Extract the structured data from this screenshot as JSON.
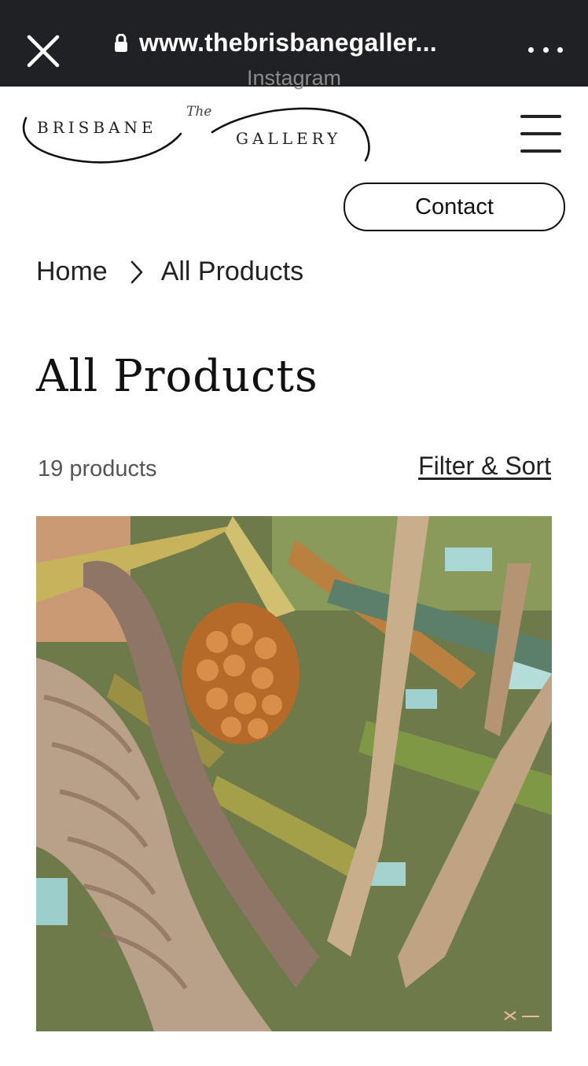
{
  "browser": {
    "url": "www.thebrisbanegaller...",
    "subtitle": "Instagram",
    "icons": {
      "close": "close-icon",
      "lock": "lock-icon",
      "more": "more-horizontal-icon"
    }
  },
  "header": {
    "logo": {
      "word1": "BRISBANE",
      "the": "The",
      "word2": "GALLERY"
    },
    "menu_icon": "hamburger-menu-icon",
    "contact_label": "Contact"
  },
  "breadcrumb": {
    "home": "Home",
    "current": "All Products",
    "separator_icon": "chevron-right-icon"
  },
  "main": {
    "title": "All Products",
    "count": "19 products",
    "filter_label": "Filter & Sort"
  },
  "product": {
    "image_subject": "painting of pandanus palm tree with fruit"
  },
  "colors": {
    "topbar": "#202124",
    "text": "#111111",
    "muted": "#555555"
  }
}
